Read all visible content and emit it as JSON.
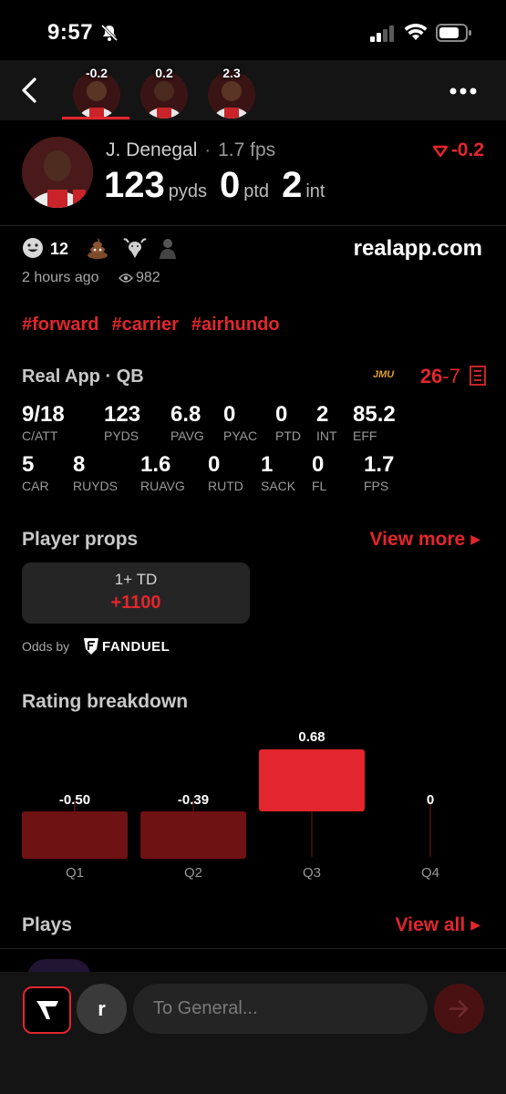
{
  "status_bar": {
    "time": "9:57"
  },
  "nav": {
    "tabs": [
      {
        "delta": "-0.2"
      },
      {
        "delta": "0.2"
      },
      {
        "delta": "2.3"
      }
    ]
  },
  "player": {
    "name": "J. Denegal",
    "fps": "1.7 fps",
    "delta": "-0.2",
    "stats": [
      {
        "value": "123",
        "unit": "pyds"
      },
      {
        "value": "0",
        "unit": "ptd"
      },
      {
        "value": "2",
        "unit": "int"
      }
    ]
  },
  "post": {
    "reaction_count": "12",
    "reaction_icons": [
      "smile-icon",
      "poop-icon",
      "goat-icon",
      "person-icon"
    ],
    "site": "realapp.com",
    "time_ago": "2 hours ago",
    "views": "982",
    "hashtags": [
      "#forward",
      "#carrier",
      "#airhundo"
    ]
  },
  "game": {
    "title": "Real App · QB",
    "team_abbr": "JMU",
    "score_home": "26",
    "score_sep": "-",
    "score_away": "7",
    "row1": [
      {
        "value": "9/18",
        "label": "C/ATT"
      },
      {
        "value": "123",
        "label": "PYDS"
      },
      {
        "value": "6.8",
        "label": "PAVG"
      },
      {
        "value": "0",
        "label": "PYAC"
      },
      {
        "value": "0",
        "label": "PTD"
      },
      {
        "value": "2",
        "label": "INT"
      },
      {
        "value": "85.2",
        "label": "EFF"
      }
    ],
    "row2": [
      {
        "value": "5",
        "label": "CAR"
      },
      {
        "value": "8",
        "label": "RUYDS"
      },
      {
        "value": "1.6",
        "label": "RUAVG"
      },
      {
        "value": "0",
        "label": "RUTD"
      },
      {
        "value": "1",
        "label": "SACK"
      },
      {
        "value": "0",
        "label": "FL"
      },
      {
        "value": "1.7",
        "label": "FPS"
      }
    ]
  },
  "props": {
    "title": "Player props",
    "view_more": "View more",
    "card_label": "1+ TD",
    "card_odds": "+1100",
    "odds_by": "Odds by",
    "provider": "FANDUEL"
  },
  "rating": {
    "title": "Rating breakdown"
  },
  "chart_data": {
    "type": "bar",
    "categories": [
      "Q1",
      "Q2",
      "Q3",
      "Q4"
    ],
    "values": [
      -0.5,
      -0.39,
      0.68,
      0
    ],
    "value_labels": [
      "-0.50",
      "-0.39",
      "0.68",
      "0"
    ],
    "colors": {
      "positive": "#e3262d",
      "negative": "#6e1214"
    }
  },
  "plays": {
    "title": "Plays",
    "view_all": "View all"
  },
  "composer": {
    "user_initial": "r",
    "placeholder": "To General..."
  },
  "colors": {
    "accent": "#e3262d",
    "background": "#000000",
    "panel": "#141414"
  }
}
